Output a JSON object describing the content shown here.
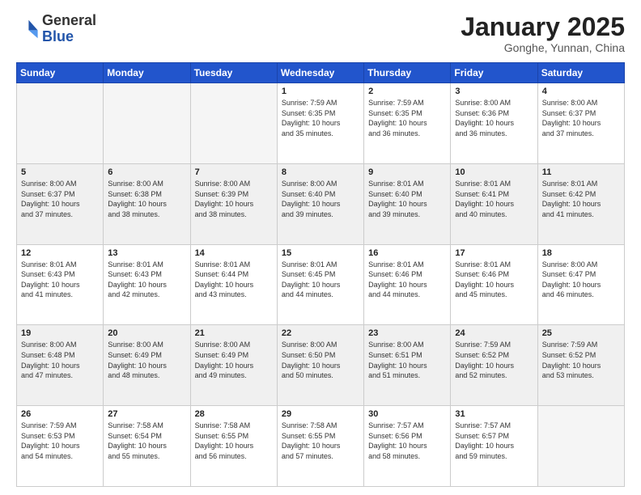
{
  "header": {
    "logo_general": "General",
    "logo_blue": "Blue",
    "month_title": "January 2025",
    "location": "Gonghe, Yunnan, China"
  },
  "weekdays": [
    "Sunday",
    "Monday",
    "Tuesday",
    "Wednesday",
    "Thursday",
    "Friday",
    "Saturday"
  ],
  "weeks": [
    [
      {
        "day": "",
        "info": ""
      },
      {
        "day": "",
        "info": ""
      },
      {
        "day": "",
        "info": ""
      },
      {
        "day": "1",
        "info": "Sunrise: 7:59 AM\nSunset: 6:35 PM\nDaylight: 10 hours\nand 35 minutes."
      },
      {
        "day": "2",
        "info": "Sunrise: 7:59 AM\nSunset: 6:35 PM\nDaylight: 10 hours\nand 36 minutes."
      },
      {
        "day": "3",
        "info": "Sunrise: 8:00 AM\nSunset: 6:36 PM\nDaylight: 10 hours\nand 36 minutes."
      },
      {
        "day": "4",
        "info": "Sunrise: 8:00 AM\nSunset: 6:37 PM\nDaylight: 10 hours\nand 37 minutes."
      }
    ],
    [
      {
        "day": "5",
        "info": "Sunrise: 8:00 AM\nSunset: 6:37 PM\nDaylight: 10 hours\nand 37 minutes."
      },
      {
        "day": "6",
        "info": "Sunrise: 8:00 AM\nSunset: 6:38 PM\nDaylight: 10 hours\nand 38 minutes."
      },
      {
        "day": "7",
        "info": "Sunrise: 8:00 AM\nSunset: 6:39 PM\nDaylight: 10 hours\nand 38 minutes."
      },
      {
        "day": "8",
        "info": "Sunrise: 8:00 AM\nSunset: 6:40 PM\nDaylight: 10 hours\nand 39 minutes."
      },
      {
        "day": "9",
        "info": "Sunrise: 8:01 AM\nSunset: 6:40 PM\nDaylight: 10 hours\nand 39 minutes."
      },
      {
        "day": "10",
        "info": "Sunrise: 8:01 AM\nSunset: 6:41 PM\nDaylight: 10 hours\nand 40 minutes."
      },
      {
        "day": "11",
        "info": "Sunrise: 8:01 AM\nSunset: 6:42 PM\nDaylight: 10 hours\nand 41 minutes."
      }
    ],
    [
      {
        "day": "12",
        "info": "Sunrise: 8:01 AM\nSunset: 6:43 PM\nDaylight: 10 hours\nand 41 minutes."
      },
      {
        "day": "13",
        "info": "Sunrise: 8:01 AM\nSunset: 6:43 PM\nDaylight: 10 hours\nand 42 minutes."
      },
      {
        "day": "14",
        "info": "Sunrise: 8:01 AM\nSunset: 6:44 PM\nDaylight: 10 hours\nand 43 minutes."
      },
      {
        "day": "15",
        "info": "Sunrise: 8:01 AM\nSunset: 6:45 PM\nDaylight: 10 hours\nand 44 minutes."
      },
      {
        "day": "16",
        "info": "Sunrise: 8:01 AM\nSunset: 6:46 PM\nDaylight: 10 hours\nand 44 minutes."
      },
      {
        "day": "17",
        "info": "Sunrise: 8:01 AM\nSunset: 6:46 PM\nDaylight: 10 hours\nand 45 minutes."
      },
      {
        "day": "18",
        "info": "Sunrise: 8:00 AM\nSunset: 6:47 PM\nDaylight: 10 hours\nand 46 minutes."
      }
    ],
    [
      {
        "day": "19",
        "info": "Sunrise: 8:00 AM\nSunset: 6:48 PM\nDaylight: 10 hours\nand 47 minutes."
      },
      {
        "day": "20",
        "info": "Sunrise: 8:00 AM\nSunset: 6:49 PM\nDaylight: 10 hours\nand 48 minutes."
      },
      {
        "day": "21",
        "info": "Sunrise: 8:00 AM\nSunset: 6:49 PM\nDaylight: 10 hours\nand 49 minutes."
      },
      {
        "day": "22",
        "info": "Sunrise: 8:00 AM\nSunset: 6:50 PM\nDaylight: 10 hours\nand 50 minutes."
      },
      {
        "day": "23",
        "info": "Sunrise: 8:00 AM\nSunset: 6:51 PM\nDaylight: 10 hours\nand 51 minutes."
      },
      {
        "day": "24",
        "info": "Sunrise: 7:59 AM\nSunset: 6:52 PM\nDaylight: 10 hours\nand 52 minutes."
      },
      {
        "day": "25",
        "info": "Sunrise: 7:59 AM\nSunset: 6:52 PM\nDaylight: 10 hours\nand 53 minutes."
      }
    ],
    [
      {
        "day": "26",
        "info": "Sunrise: 7:59 AM\nSunset: 6:53 PM\nDaylight: 10 hours\nand 54 minutes."
      },
      {
        "day": "27",
        "info": "Sunrise: 7:58 AM\nSunset: 6:54 PM\nDaylight: 10 hours\nand 55 minutes."
      },
      {
        "day": "28",
        "info": "Sunrise: 7:58 AM\nSunset: 6:55 PM\nDaylight: 10 hours\nand 56 minutes."
      },
      {
        "day": "29",
        "info": "Sunrise: 7:58 AM\nSunset: 6:55 PM\nDaylight: 10 hours\nand 57 minutes."
      },
      {
        "day": "30",
        "info": "Sunrise: 7:57 AM\nSunset: 6:56 PM\nDaylight: 10 hours\nand 58 minutes."
      },
      {
        "day": "31",
        "info": "Sunrise: 7:57 AM\nSunset: 6:57 PM\nDaylight: 10 hours\nand 59 minutes."
      },
      {
        "day": "",
        "info": ""
      }
    ]
  ]
}
